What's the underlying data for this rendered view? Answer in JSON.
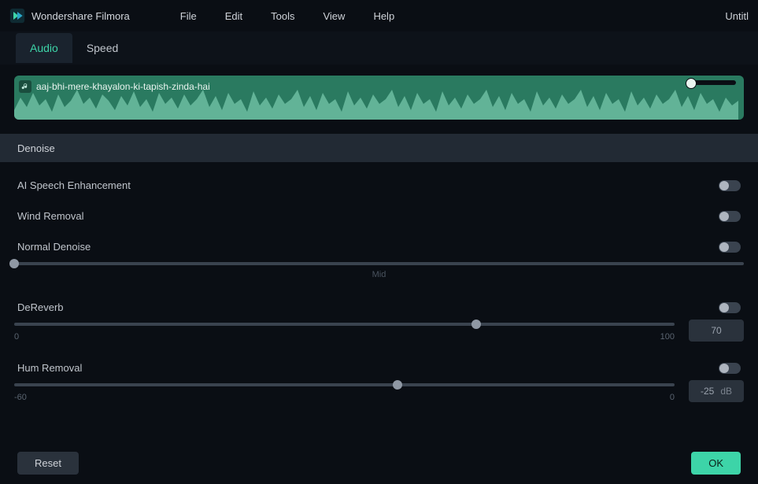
{
  "app": {
    "name": "Wondershare Filmora",
    "document_title": "Untitl"
  },
  "menu": [
    "File",
    "Edit",
    "Tools",
    "View",
    "Help"
  ],
  "tabs": [
    {
      "label": "Audio",
      "active": true
    },
    {
      "label": "Speed",
      "active": false
    }
  ],
  "clip": {
    "name": "aaj-bhi-mere-khayalon-ki-tapish-zinda-hai"
  },
  "section": {
    "title": "Denoise"
  },
  "controls": {
    "ai_speech": {
      "label": "AI Speech Enhancement",
      "on": false
    },
    "wind": {
      "label": "Wind Removal",
      "on": false
    },
    "normal": {
      "label": "Normal Denoise",
      "on": false,
      "ticks": {
        "low": "",
        "mid": "Mid",
        "hi": ""
      },
      "pos_pct": 0
    },
    "dereverb": {
      "label": "DeReverb",
      "on": false,
      "min": "0",
      "max": "100",
      "value": "70",
      "pos_pct": 70
    },
    "hum": {
      "label": "Hum Removal",
      "on": false,
      "min": "-60",
      "max": "0",
      "value": "-25",
      "unit": "dB",
      "pos_pct": 58
    }
  },
  "footer": {
    "reset_label": "Reset",
    "ok_label": "OK"
  }
}
